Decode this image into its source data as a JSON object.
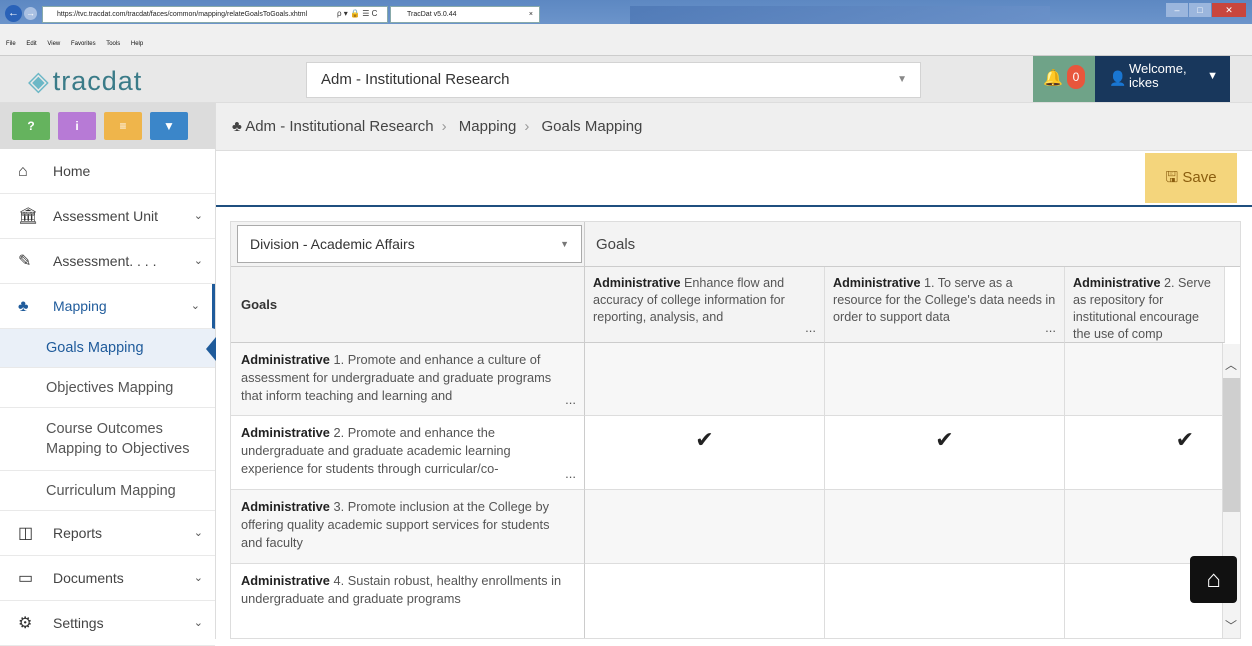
{
  "browser": {
    "url": "https://tvc.tracdat.com/tracdat/faces/common/mapping/relateGoalsToGoals.xhtml",
    "addr_icons": "ρ ▾ 🔒 ☰ C",
    "tab_title": "TracDat v5.0.44",
    "menus": [
      "File",
      "Edit",
      "View",
      "Favorites",
      "Tools",
      "Help"
    ]
  },
  "app": {
    "logo": "tracdat",
    "unit_selector": "Adm - Institutional Research",
    "notifications_count": "0",
    "welcome": "Welcome,",
    "user": "ickes"
  },
  "quick_actions": [
    "?",
    "i",
    "≡",
    "▼"
  ],
  "sidebar": {
    "home": "Home",
    "assessment_unit": "Assessment Unit",
    "assessment": "Assessment. . . .",
    "mapping": "Mapping",
    "sub": [
      "Goals Mapping",
      "Objectives Mapping",
      "Course Outcomes Mapping to Objectives",
      "Curriculum Mapping"
    ],
    "reports": "Reports",
    "documents": "Documents",
    "settings": "Settings"
  },
  "breadcrumb": [
    "Adm - Institutional Research",
    "Mapping",
    "Goals Mapping"
  ],
  "toolbar": {
    "save": "Save"
  },
  "grid": {
    "division_select": "Division - Academic Affairs",
    "goals_top": "Goals",
    "goals_row_header": "Goals",
    "columns": [
      {
        "bold": "Administrative",
        "text": " Enhance flow and accuracy of college information for reporting, analysis, and"
      },
      {
        "bold": "Administrative",
        "text": " 1. To serve as a resource for the College's data needs in order to support data"
      },
      {
        "bold": "Administrative",
        "text": " 2. Serve as repository for institutional encourage the use of comp"
      }
    ],
    "rows": [
      {
        "bold": "Administrative",
        "text": " 1. Promote and enhance a culture of assessment for undergraduate and graduate programs that inform teaching and learning and",
        "checks": [
          "",
          "",
          ""
        ]
      },
      {
        "bold": "Administrative",
        "text": " 2. Promote and enhance the undergraduate and graduate academic learning experience for students through curricular/co-",
        "checks": [
          "✔",
          "✔",
          "✔"
        ]
      },
      {
        "bold": "Administrative",
        "text": " 3. Promote inclusion at the College by offering quality academic support services for students and faculty",
        "checks": [
          "",
          "",
          ""
        ]
      },
      {
        "bold": "Administrative",
        "text": " 4. Sustain robust, healthy enrollments in undergraduate and graduate programs",
        "checks": [
          "",
          "",
          ""
        ]
      }
    ],
    "ellipsis": "..."
  },
  "icons": {
    "home_fab": "home-icon"
  }
}
